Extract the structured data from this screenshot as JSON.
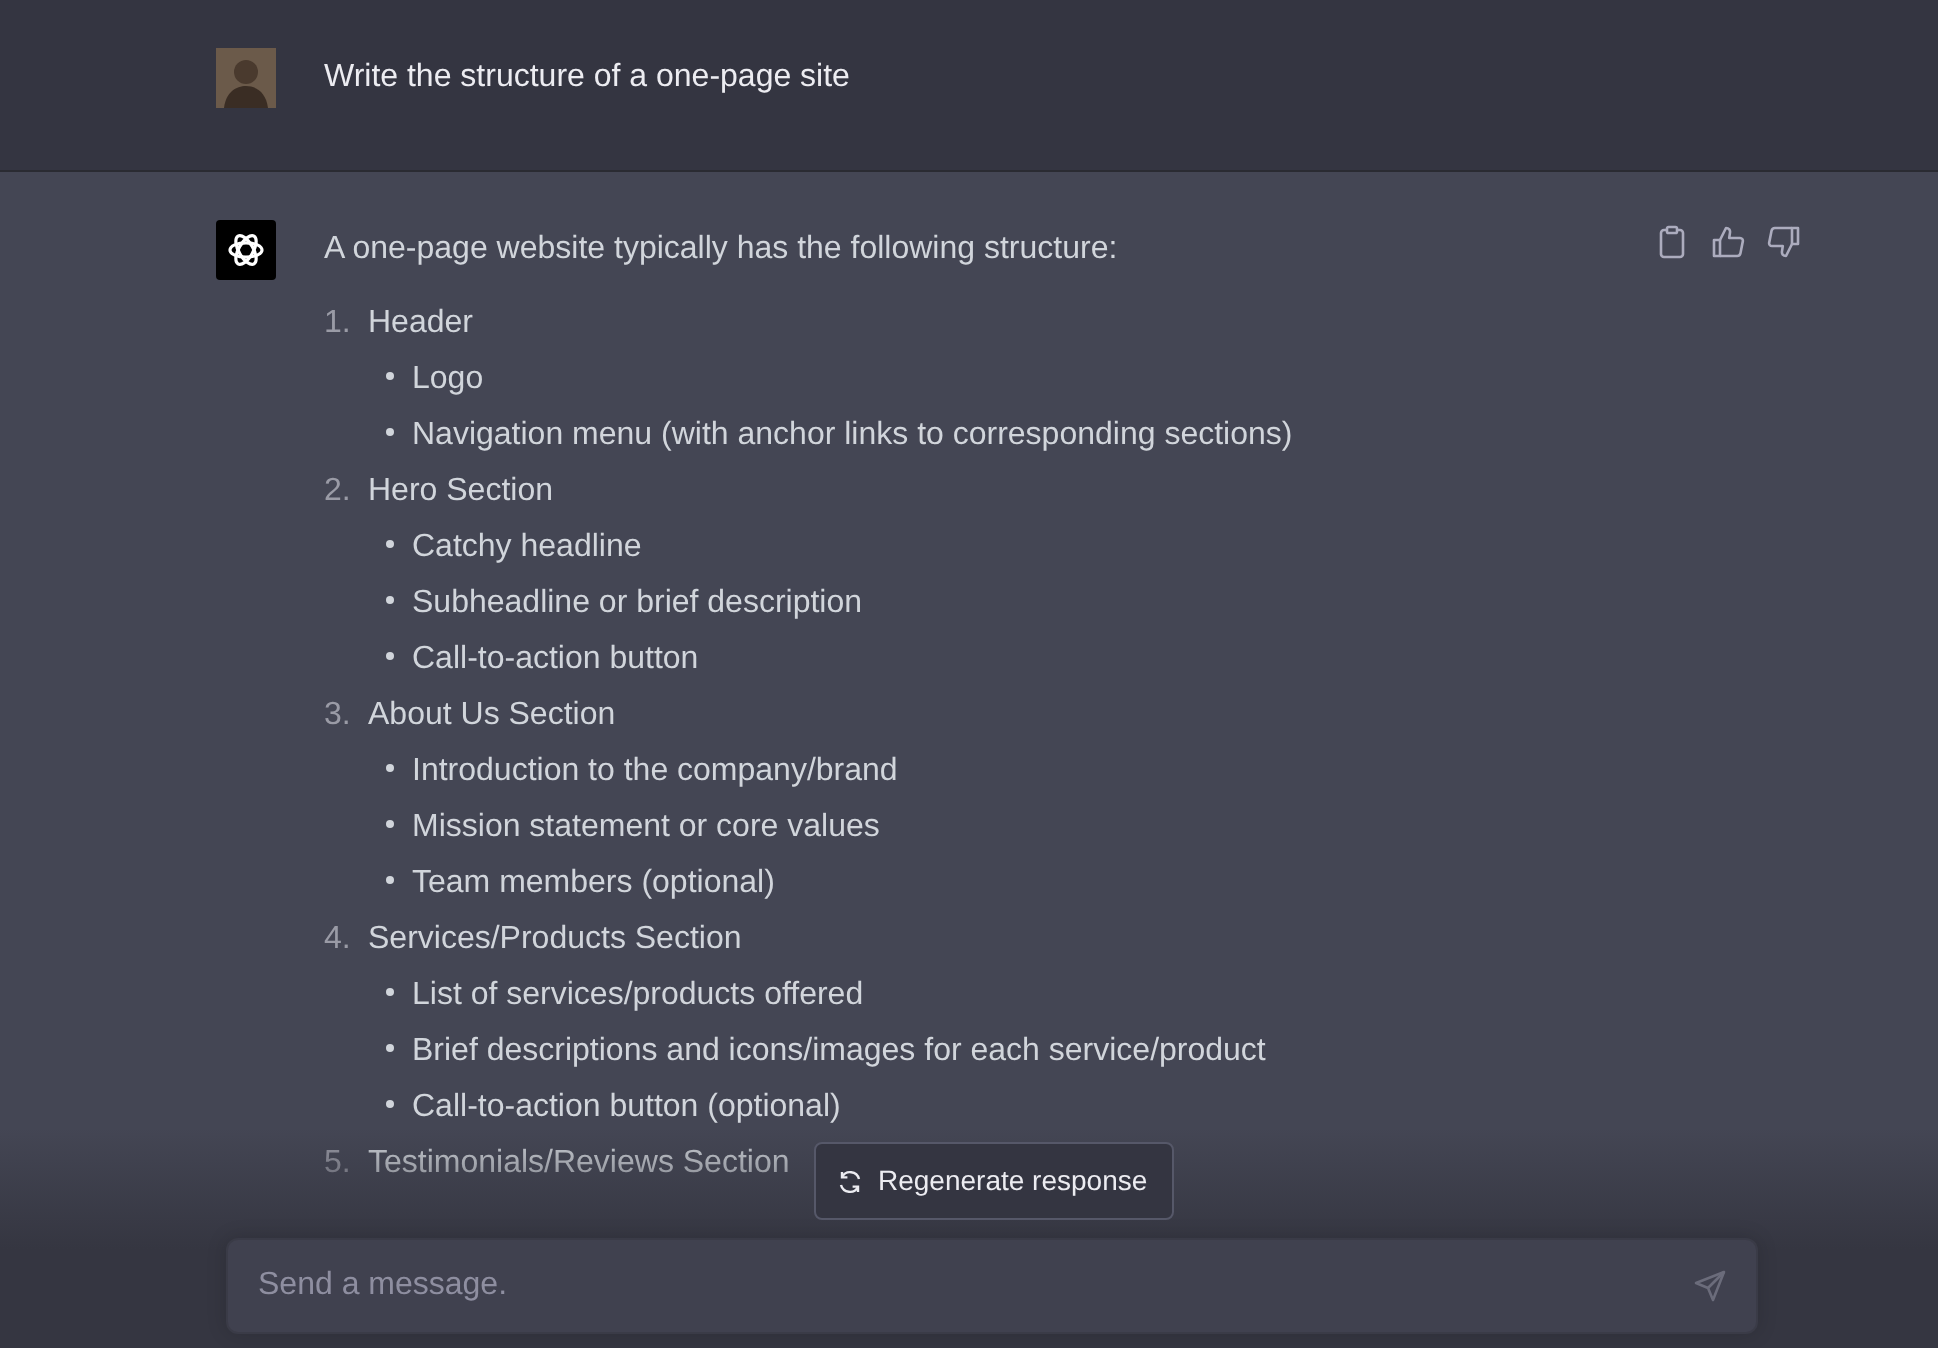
{
  "user_message": {
    "text": "Write the structure of a one-page site"
  },
  "assistant_message": {
    "intro": "A one-page website typically has the following structure:",
    "items": [
      {
        "number": "1.",
        "title": "Header",
        "children": [
          "Logo",
          "Navigation menu (with anchor links to corresponding sections)"
        ]
      },
      {
        "number": "2.",
        "title": "Hero Section",
        "children": [
          "Catchy headline",
          "Subheadline or brief description",
          "Call-to-action button"
        ]
      },
      {
        "number": "3.",
        "title": "About Us Section",
        "children": [
          "Introduction to the company/brand",
          "Mission statement or core values",
          "Team members (optional)"
        ]
      },
      {
        "number": "4.",
        "title": "Services/Products Section",
        "children": [
          "List of services/products offered",
          "Brief descriptions and icons/images for each service/product",
          "Call-to-action button (optional)"
        ]
      },
      {
        "number": "5.",
        "title": "Testimonials/Reviews Section"
      }
    ]
  },
  "regenerate_button": {
    "label": "Regenerate response"
  },
  "composer": {
    "placeholder": "Send a message."
  }
}
